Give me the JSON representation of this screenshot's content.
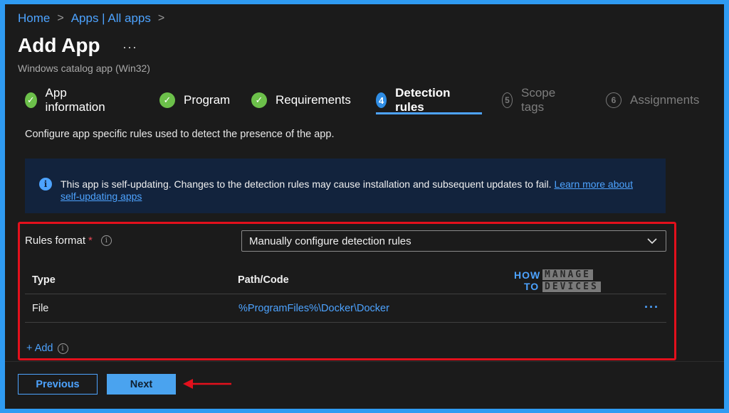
{
  "breadcrumb": {
    "home": "Home",
    "apps": "Apps | All apps",
    "separator": ">"
  },
  "page": {
    "title": "Add App",
    "more": "···",
    "subtitle": "Windows catalog app (Win32)"
  },
  "steps": [
    {
      "label": "App information",
      "status": "done",
      "icon": "checkmark-icon"
    },
    {
      "label": "Program",
      "status": "done",
      "icon": "checkmark-icon"
    },
    {
      "label": "Requirements",
      "status": "done",
      "icon": "checkmark-icon"
    },
    {
      "label": "Detection rules",
      "status": "active",
      "number": "4"
    },
    {
      "label": "Scope tags",
      "status": "pending",
      "number": "5"
    },
    {
      "label": "Assignments",
      "status": "pending",
      "number": "6"
    }
  ],
  "description": "Configure app specific rules used to detect the presence of the app.",
  "info": {
    "text": "This app is self-updating. Changes to the detection rules may cause installation and subsequent updates to fail.",
    "link": "Learn more about self-updating apps"
  },
  "rules": {
    "label": "Rules format",
    "required_mark": "*",
    "selected": "Manually configure detection rules"
  },
  "table": {
    "headers": {
      "type": "Type",
      "path": "Path/Code"
    },
    "rows": [
      {
        "type": "File",
        "path": "%ProgramFiles%\\Docker\\Docker",
        "more": "···"
      }
    ]
  },
  "add_label": "+ Add",
  "watermark": {
    "how": "HOW",
    "to": "TO",
    "manage": "MANAGE",
    "devices": "DEVICES"
  },
  "footer": {
    "previous": "Previous",
    "next": "Next"
  },
  "colors": {
    "accent": "#4da3ff",
    "done_green": "#6cc04a",
    "highlight_red": "#e3101c",
    "background": "#1b1b1b",
    "outer_border": "#2f9bf2"
  }
}
